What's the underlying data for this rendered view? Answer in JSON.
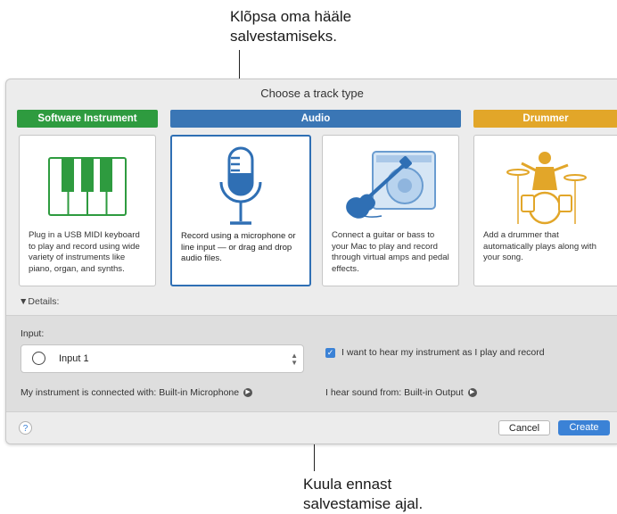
{
  "callouts": {
    "top_line1": "Klõpsa oma hääle",
    "top_line2": "salvestamiseks.",
    "bottom_line1": "Kuula ennast",
    "bottom_line2": "salvestamise ajal."
  },
  "dialog": {
    "title": "Choose a track type",
    "categories": [
      {
        "label": "Software Instrument",
        "color": "#2e9b3f"
      },
      {
        "label": "Audio",
        "color": "#3a76b5"
      },
      {
        "label": "Drummer",
        "color": "#e2a629"
      }
    ],
    "cards": [
      {
        "icon": "piano-keyboard-icon",
        "desc": "Plug in a USB MIDI keyboard to play and record using wide variety of instruments like piano, organ, and synths."
      },
      {
        "icon": "microphone-icon",
        "desc": "Record using a microphone or line input — or drag and drop audio files."
      },
      {
        "icon": "guitar-amp-icon",
        "desc": "Connect a guitar or bass to your Mac to play and record through virtual amps and pedal effects."
      },
      {
        "icon": "drummer-icon",
        "desc": "Add a drummer that automatically plays along with your song."
      }
    ],
    "details_label": "▼Details:",
    "input_label": "Input:",
    "input_value": "Input 1",
    "monitor_checkbox_label": "I want to hear my instrument as I play and record",
    "monitor_checked": true,
    "connected_with": "My instrument is connected with: Built-in Microphone",
    "hear_from": "I hear sound from: Built-in Output",
    "help_label": "?",
    "cancel_label": "Cancel",
    "create_label": "Create",
    "accent_color": "#3b82d6"
  }
}
